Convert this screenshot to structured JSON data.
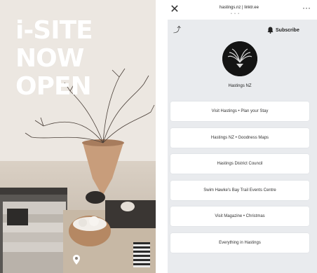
{
  "photo": {
    "headline": "i-SITE NOW OPEN",
    "footer_text": "",
    "icons": {
      "pin": "location-pin-icon"
    }
  },
  "header": {
    "close_icon": "close-icon",
    "title": "hastings.nz | linktr.ee",
    "dots": "• • •",
    "more_icon": "more-icon"
  },
  "profile": {
    "share_icon": "share-icon",
    "subscribe_label": "Subscribe",
    "bell_icon": "bell-icon",
    "handle": "Hastings NZ"
  },
  "links": [
    {
      "label": "Visit Hastings • Plan your Stay"
    },
    {
      "label": "Hastings NZ • Goodness Maps"
    },
    {
      "label": "Hastings District Council"
    },
    {
      "label": "Swim Hawke's Bay Trail Events Centre"
    },
    {
      "label": "Visit Magazine • Christmas"
    },
    {
      "label": "Everything in Hastings"
    }
  ],
  "colors": {
    "panel_bg": "#e9ebee",
    "card_bg": "#ffffff",
    "headline": "#ffffff"
  }
}
